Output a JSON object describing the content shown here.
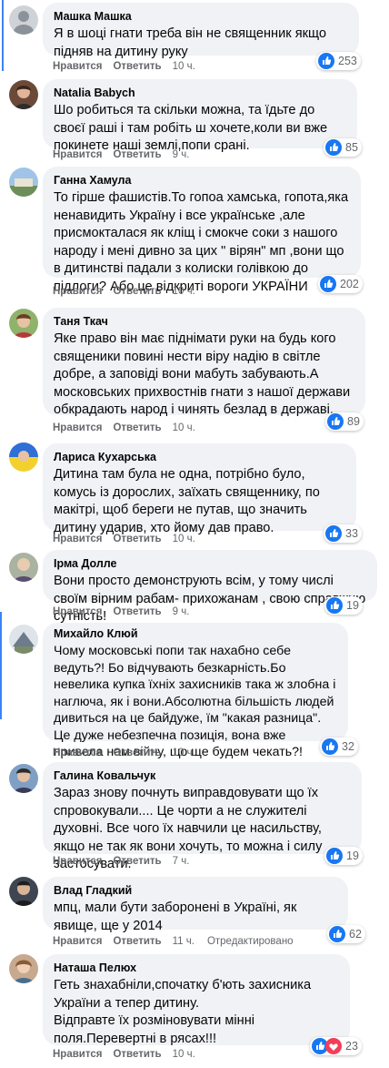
{
  "labels": {
    "like": "Нравится",
    "reply": "Ответить",
    "edited": "Отредактировано"
  },
  "colors": {
    "like_blue": "#1877f2",
    "heart_red": "#f33e58",
    "bubble_bg": "#f0f2f5",
    "meta_gray": "#65676b"
  },
  "comments": [
    {
      "author": "Машка Машка",
      "text": "Я в шоці гнати треба він не священник якщо підняв на дитину руку",
      "time": "10 ч.",
      "reactions": "253"
    },
    {
      "author": "Natalia Babych",
      "text": "Шо робиться та скільки можна, та їдьте до своєї раші і там робіть ш хочете,коли ви вже покинете наші землі,попи срані.",
      "time": "9 ч.",
      "reactions": "85"
    },
    {
      "author": "Ганна Хамула",
      "text": "То гірше фашистів.То гопоа хамська, гопота,яка ненавидить Україну і все українське ,але присмокталася як кліщ і смокче соки з нашого народу і мені дивно за цих \" вірян\" мп ,вони що в дитинстві падали з колиски голівкою до підлоги? Або це відкриті вороги УКРАЇНИ",
      "time": "10 ч.",
      "reactions": "202"
    },
    {
      "author": "Таня Ткач",
      "text": "Яке право він має піднімати руки на будь кого священики повині нести віру надію в світле добре, а заповіді вони мабуть забувають.А московських прихвостнів гнати з нашої держави обкрадають народ і чинять безлад в державі.",
      "time": "10 ч.",
      "reactions": "89"
    },
    {
      "author": "Лариса Кухарська",
      "text": "Дитина там була не одна, потрібно було, комусь із дорослих, заїхать священнику, по макітрі, щоб береги не путав, що значить дитину ударив, хто йому дав право.",
      "time": "10 ч.",
      "reactions": "33"
    },
    {
      "author": "Ірма Долле",
      "text": "Вони просто демонструють всім, у тому числі своїм вірним рабам- прихожанам , свою справжню сутність!",
      "time": "9 ч.",
      "reactions": "19"
    },
    {
      "author": "Михайло Клюй",
      "text": "Чому московські попи так нахабно себе ведуть?! Бо відчувають безкарність.Бо невелика купка їхніх захисників така ж злобна і наглюча, як і вони.Абсолютна більшість людей дивиться на це байдуже, їм \"какая разница\". Це дуже небезпечна позиція, вона вже привела нам війну, що ще будем чекать?!",
      "time": "10 ч.",
      "reactions": "32"
    },
    {
      "author": "Галина Ковальчук",
      "text": "Зараз знову почнуть виправдовувати що їх спровокували.... Це чорти а не служителі духовні. Все чого їх навчили це насильству, якщо не так як вони хочуть, то можна і силу застосувати.",
      "time": "7 ч.",
      "reactions": "19"
    },
    {
      "author": "Влад Гладкий",
      "text": "мпц, мали бути заборонені в Україні, як явище, ще у 2014",
      "time": "11 ч.",
      "reactions": "62"
    },
    {
      "author": "Наташа Пелюх",
      "text": "Геть знахабніли,спочатку б'ють захисника України а тепер дитину.\nВідправте їх розміновувати мінні поля.Перевертні в рясах!!!",
      "time": "10 ч.",
      "reactions": "23"
    }
  ]
}
